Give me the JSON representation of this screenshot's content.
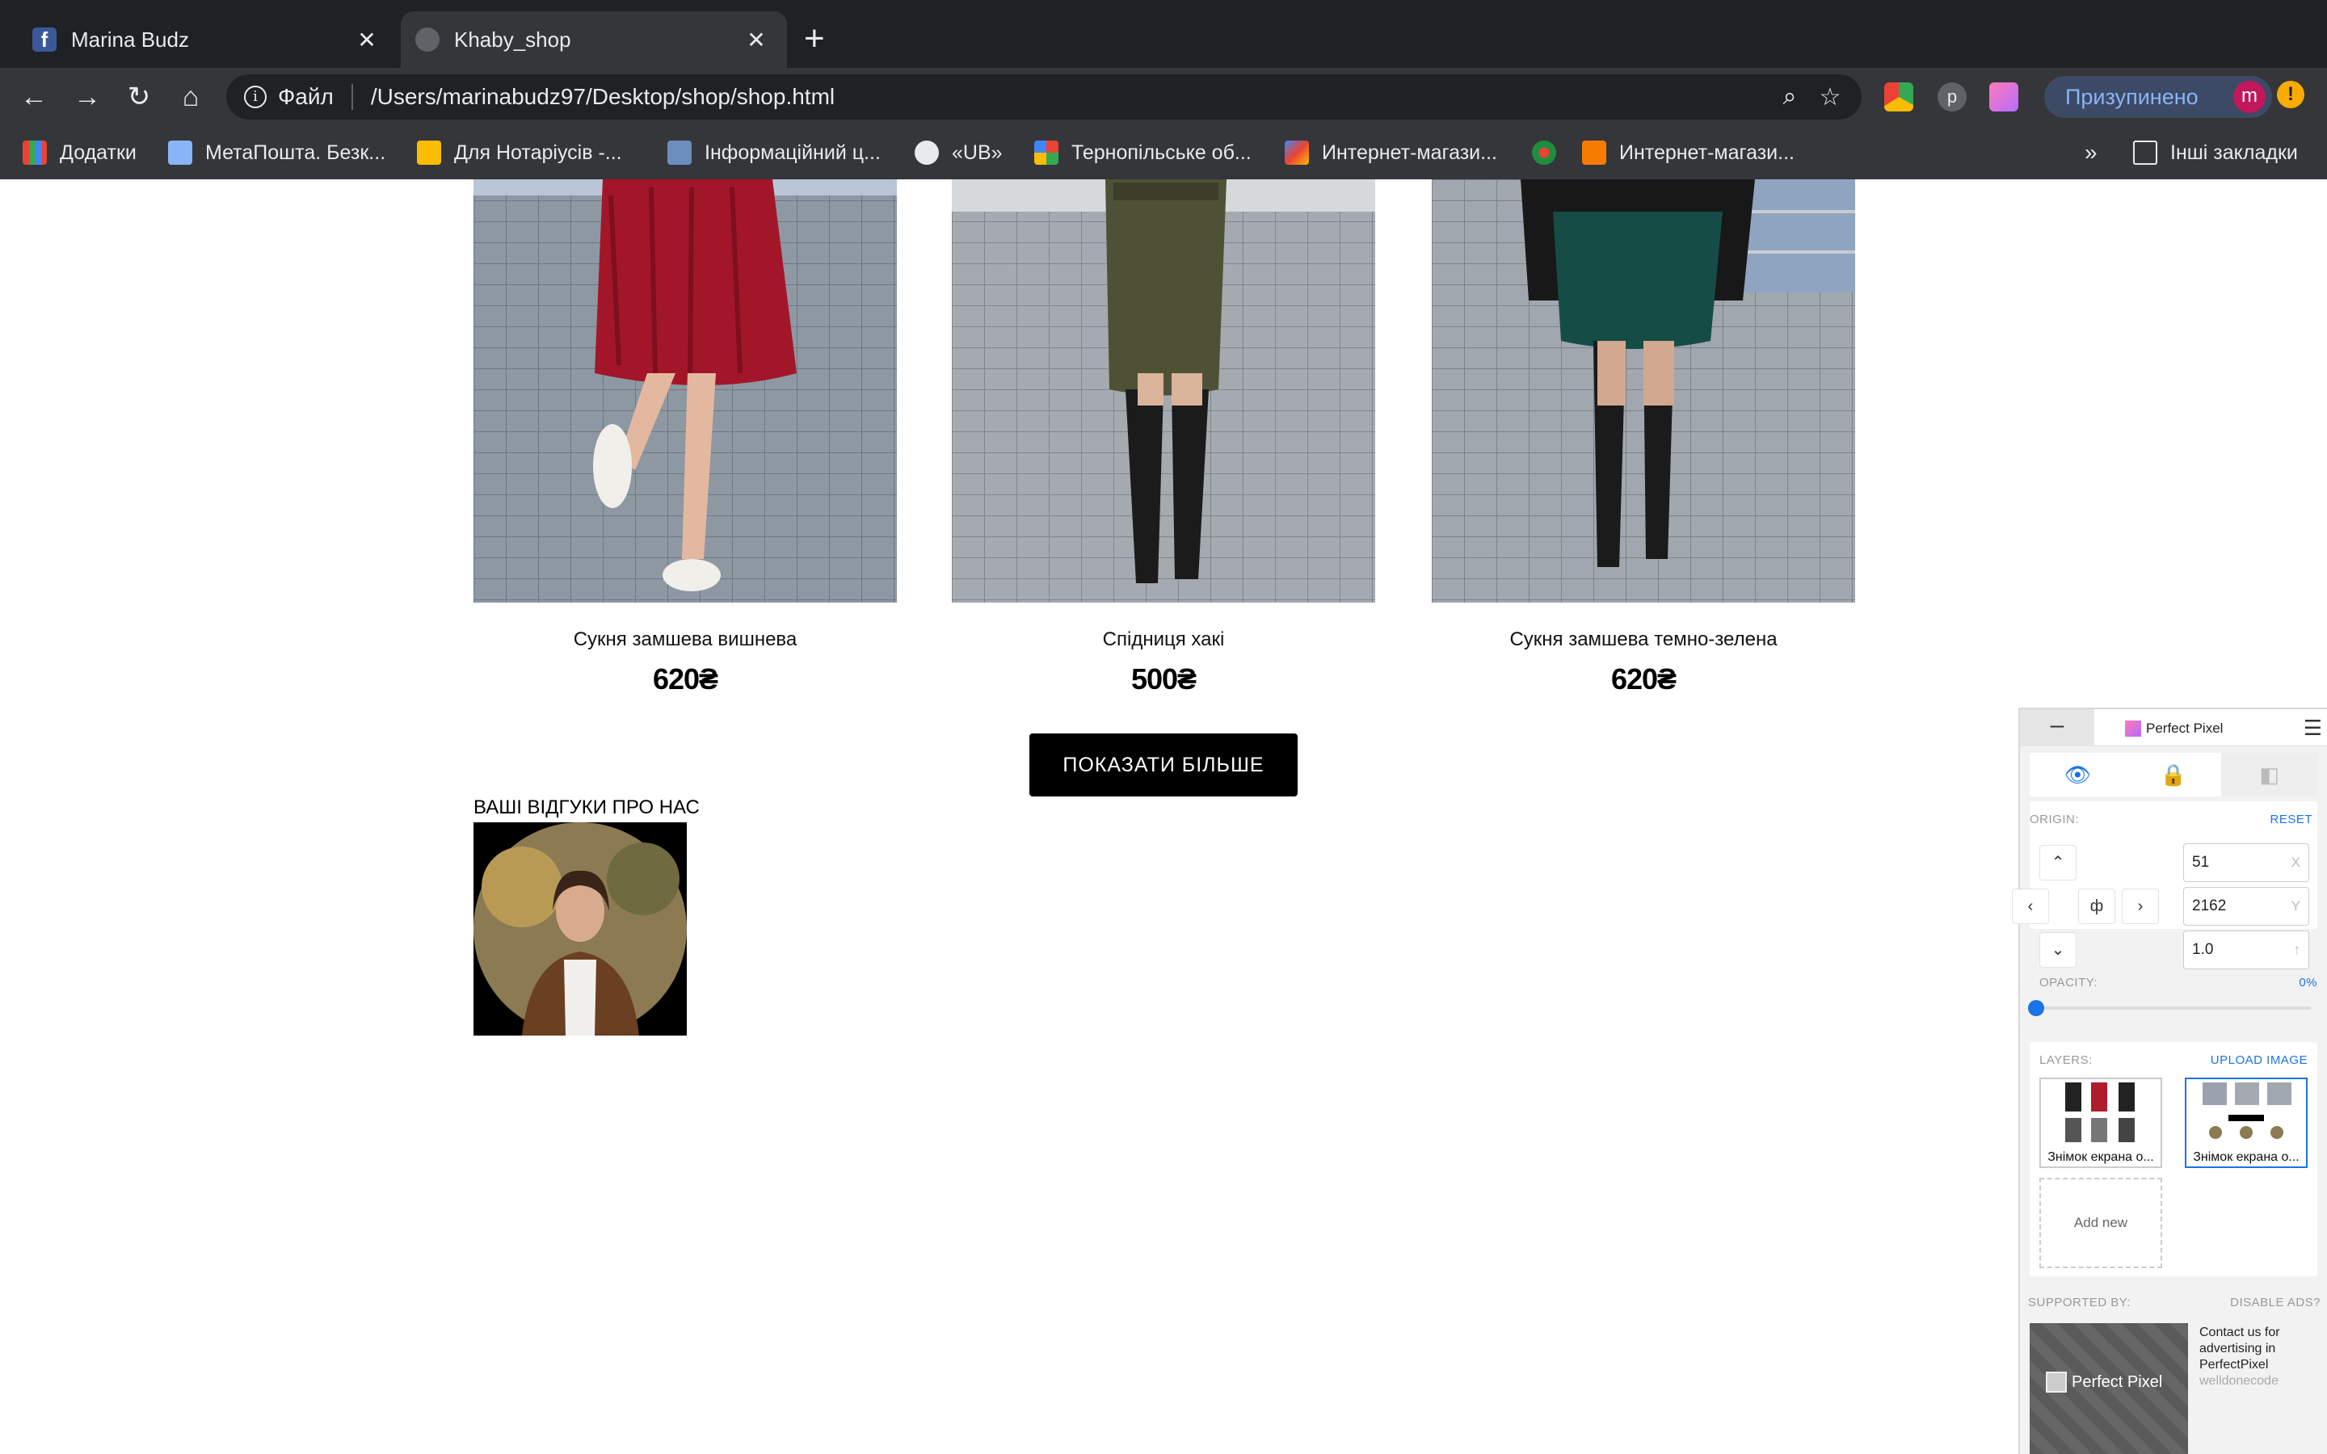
{
  "browser": {
    "tabs": [
      {
        "title": "Marina Budz",
        "icon": "facebook-icon",
        "active": false
      },
      {
        "title": "Khaby_shop",
        "icon": "globe-icon",
        "active": true
      }
    ],
    "address": {
      "scheme": "Файл",
      "url": "/Users/marinabudz97/Desktop/shop/shop.html"
    },
    "profile": {
      "label": "Призупинено",
      "initial": "m"
    },
    "notification": "!",
    "bookmarks": [
      {
        "label": "Додатки",
        "icon": "apps-grid-icon"
      },
      {
        "label": "МетаПошта. Безк...",
        "icon": "metaposhta-icon"
      },
      {
        "label": "Для Нотаріусів -...",
        "icon": "notary-icon"
      },
      {
        "label": "Інформаційний ц...",
        "icon": "info-center-icon"
      },
      {
        "label": "«UB»",
        "icon": "globe-icon"
      },
      {
        "label": "Тернопільське об...",
        "icon": "ternopil-icon"
      },
      {
        "label": "Интернет-магази...",
        "icon": "shop-icon"
      },
      {
        "label": "",
        "icon": "emblem-icon"
      },
      {
        "label": "Интернет-магази...",
        "icon": "shop2-icon"
      }
    ],
    "bookmarks_overflow": "»",
    "other_bookmarks": "Інші закладки"
  },
  "shop": {
    "products": [
      {
        "name": "Сукня замшева вишнева",
        "price": "620₴",
        "color": "#a3162a"
      },
      {
        "name": "Спідниця хакі",
        "price": "500₴",
        "color": "#4f5137"
      },
      {
        "name": "Сукня замшева темно-зелена",
        "price": "620₴",
        "color": "#164c46"
      }
    ],
    "show_more": "ПОКАЗАТИ БІЛЬШЕ",
    "reviews_title": "ВАШІ ВІДГУКИ ПРО НАС"
  },
  "perfect_pixel": {
    "title": "Perfect Pixel",
    "minimize": "–",
    "origin_label": "ORIGIN:",
    "reset": "RESET",
    "x": "51",
    "x_axis": "X",
    "y": "2162",
    "y_axis": "Y",
    "scale": "1.0",
    "scale_axis": "↑",
    "center": "ф",
    "opacity_label": "OPACITY:",
    "opacity_value": "0%",
    "opacity": 0,
    "layers_label": "LAYERS:",
    "upload": "UPLOAD IMAGE",
    "layers": [
      {
        "caption": "Знімок екрана о..."
      },
      {
        "caption": "Знімок екрана о..."
      }
    ],
    "add_new": "Add new",
    "supported_by": "SUPPORTED BY:",
    "disable_ads": "DISABLE ADS?",
    "ad_brand": "Perfect Pixel",
    "ad_text": "Contact us for advertising in PerfectPixel",
    "ad_company": "welldonecode"
  }
}
